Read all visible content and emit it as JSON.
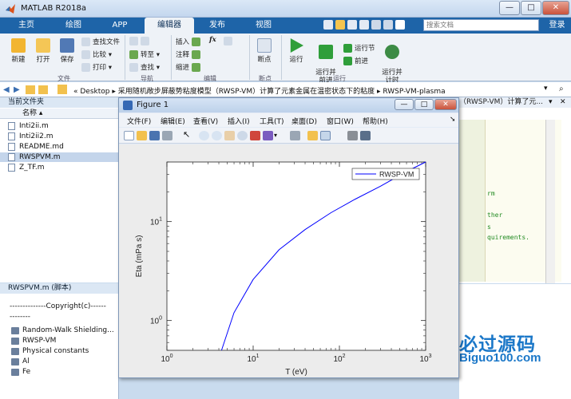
{
  "window": {
    "title": "MATLAB R2018a",
    "controls": {
      "minimize": "—",
      "maximize": "□",
      "close": "✕"
    }
  },
  "tabs": [
    "主页",
    "绘图",
    "APP",
    "编辑器",
    "发布",
    "视图"
  ],
  "active_tab": "编辑器",
  "search_placeholder": "搜索文档",
  "login_label": "登录",
  "ribbon": {
    "file": {
      "new": "新建",
      "open": "打开",
      "save": "保存",
      "find_files": "查找文件",
      "compare": "比较",
      "print": "打印",
      "group": "文件"
    },
    "navigate": {
      "goto": "转至",
      "find": "查找",
      "group": "导航"
    },
    "edit": {
      "insert": "插入",
      "fx": "fx",
      "comment": "注释",
      "indent": "缩进",
      "group": "编辑"
    },
    "breakpoints": {
      "breakpoints": "断点",
      "group": "断点"
    },
    "run": {
      "run": "运行",
      "run_advance": "运行并\n前进",
      "run_section": "运行节",
      "advance": "前进",
      "run_time": "运行并\n计时",
      "group": "运行"
    }
  },
  "address": {
    "path": "« Desktop ▸ 采用随机敞步屏蔽势粘度模型（RWSP-VM）计算了元素金属在温密状态下的粘度 ▸ RWSP-VM-plasma"
  },
  "folder_panel": {
    "title": "当前文件夹",
    "column": "名称 ▴",
    "files": [
      "Inti2ii.m",
      "Inti2ii2.m",
      "README.md",
      "RWSPVM.m",
      "Z_TF.m"
    ],
    "selected": "RWSPVM.m"
  },
  "details_panel": {
    "title": "RWSPVM.m  (脚本)",
    "lines": [
      "--------------Copyright(c)------",
      "--------"
    ],
    "items": [
      "Random-Walk Shielding...",
      "RWSP-VM",
      "Physical constants",
      "Al",
      "Fe"
    ]
  },
  "editor": {
    "path": "（RWSP-VM）计算了元...",
    "code_lines": [
      "rm",
      "ther",
      "s",
      "quirements."
    ]
  },
  "watermark": {
    "main": "必过源码",
    "sub": "Biguo100.com"
  },
  "figure": {
    "title": "Figure 1",
    "menus": [
      "文件(F)",
      "编辑(E)",
      "查看(V)",
      "插入(I)",
      "工具(T)",
      "桌面(D)",
      "窗口(W)",
      "帮助(H)"
    ]
  },
  "colors": {
    "ribbon_blue": "#1e64a8",
    "plot_line": "#0000ff",
    "watermark": "#1a77c8"
  },
  "chart_data": {
    "type": "line",
    "x_scale": "log",
    "y_scale": "log",
    "xlim": [
      1,
      1000
    ],
    "ylim": [
      0.5,
      40
    ],
    "x_ticks": [
      1,
      10,
      100,
      1000
    ],
    "x_tick_labels": [
      "10^0",
      "10^1",
      "10^2",
      "10^3"
    ],
    "y_ticks": [
      1,
      10
    ],
    "y_tick_labels": [
      "10^0",
      "10^1"
    ],
    "xlabel": "T (eV)",
    "ylabel": "Eta (mPa s)",
    "grid": false,
    "legend_position": "top-right",
    "series": [
      {
        "name": "RWSP-VM",
        "color": "#0000ff",
        "x": [
          4.3,
          6,
          10,
          20,
          40,
          80,
          150,
          300,
          600,
          1000
        ],
        "y": [
          0.5,
          1.2,
          2.6,
          5.2,
          8.3,
          12.3,
          16.7,
          22.8,
          32,
          40
        ]
      }
    ]
  }
}
